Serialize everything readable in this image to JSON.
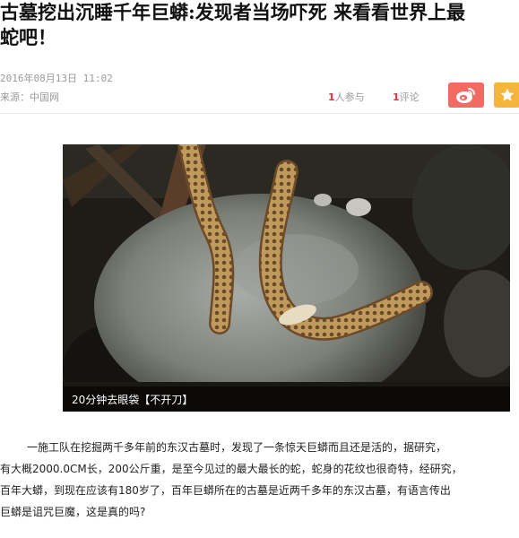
{
  "article": {
    "title_line1": "古墓挖出沉睡千年巨蟒:发现者当场吓死 来看看世界上最",
    "title_line2": "蛇吧！",
    "date": "2016年08月13日 11:02",
    "source": "来源：中国网",
    "participants_count": "1",
    "participants_label": "人参与",
    "comments_count": "1",
    "comments_label": "评论",
    "image_caption": "20分钟去眼袋【不开刀】",
    "body_lines": [
      "一施工队在挖掘两千多年前的东汉古墓时，发现了一条惊天巨蟒而且还是活的，据研究，",
      "有大概2000.0CM长，200公斤重，是至今见过的最大最长的蛇，蛇身的花纹也很奇特，经研究，",
      "百年大蟒，到现在应该有180岁了，百年巨蟒所在的古墓是近两千多年的东汉古墓，有语言传出",
      "巨蟒是诅咒巨魔，这是真的吗?"
    ]
  },
  "share": {
    "weibo_icon": "weibo-icon",
    "favorite_icon": "star-icon",
    "weibo_color": "#f26b63",
    "favorite_color": "#f5b43a"
  },
  "colors": {
    "accent_red": "#e0333c",
    "muted_text": "#999999"
  }
}
